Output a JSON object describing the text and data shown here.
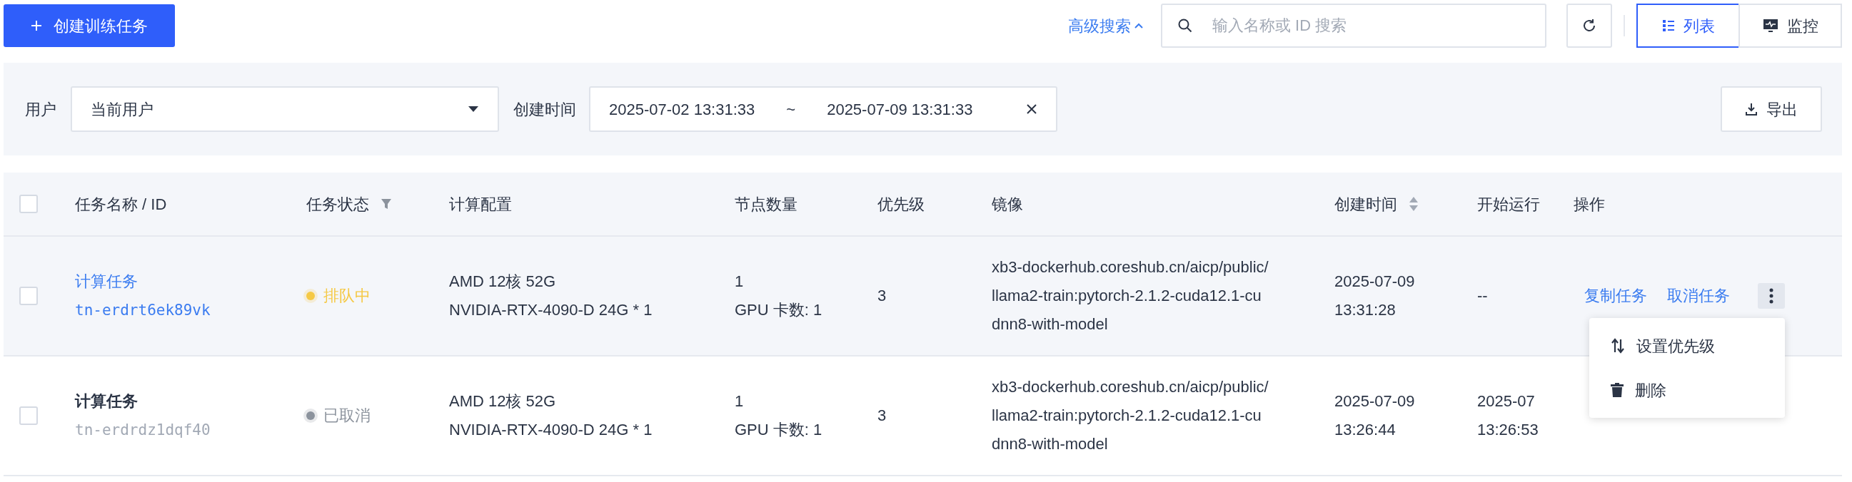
{
  "toolbar": {
    "create_button": "创建训练任务",
    "advanced_search": "高级搜索",
    "search": {
      "placeholder": "输入名称或 ID 搜索"
    },
    "view_tabs": [
      {
        "label": "列表",
        "kind": "list",
        "selected": true
      },
      {
        "label": "监控",
        "kind": "monitor",
        "selected": false
      }
    ]
  },
  "filters": {
    "user_label": "用户",
    "user_value": "当前用户",
    "time_label": "创建时间",
    "time_start": "2025-07-02 13:31:33",
    "time_sep": "~",
    "time_end": "2025-07-09 13:31:33",
    "export_button": "导出"
  },
  "table": {
    "select_all_checked": false,
    "columns": [
      {
        "label": "任务名称 / ID"
      },
      {
        "label": "任务状态",
        "kind": "filter"
      },
      {
        "label": "计算配置"
      },
      {
        "label": "节点数量"
      },
      {
        "label": "优先级"
      },
      {
        "label": "镜像"
      },
      {
        "label": "创建时间",
        "kind": "sort"
      },
      {
        "label": "开始运行"
      },
      {
        "label": "操作"
      }
    ],
    "rows": [
      {
        "checked": false,
        "hovered": true,
        "name": "计算任务",
        "id": "tn-erdrt6ek89vk",
        "link": true,
        "status": "排队中",
        "color": "#f5c945",
        "config": [
          "AMD 12核 52G",
          "NVIDIA-RTX-4090-D 24G * 1"
        ],
        "nodes": [
          "1",
          "GPU 卡数: 1"
        ],
        "priority": "3",
        "image": "xb3-dockerhub.coreshub.cn/aicp/public/llama2-train:pytorch-2.1.2-cuda12.1-cudnn8-with-model",
        "created": [
          "2025-07-09",
          "13:31:28"
        ],
        "started": [
          "--"
        ],
        "actions": [
          "复制任务",
          "取消任务"
        ]
      },
      {
        "checked": false,
        "hovered": false,
        "name": "计算任务",
        "id": "tn-erdrdz1dqf40",
        "link": false,
        "status": "已取消",
        "color": "#8c939d",
        "config": [
          "AMD 12核 52G",
          "NVIDIA-RTX-4090-D 24G * 1"
        ],
        "nodes": [
          "1",
          "GPU 卡数: 1"
        ],
        "priority": "3",
        "image": "xb3-dockerhub.coreshub.cn/aicp/public/llama2-train:pytorch-2.1.2-cuda12.1-cudnn8-with-model",
        "created": [
          "2025-07-09",
          "13:26:44"
        ],
        "started": [
          "2025-07",
          "13:26:53"
        ]
      }
    ]
  },
  "menu": {
    "items": [
      {
        "label": "设置优先级",
        "kind": "priority"
      },
      {
        "label": "删除",
        "kind": "delete"
      }
    ]
  }
}
